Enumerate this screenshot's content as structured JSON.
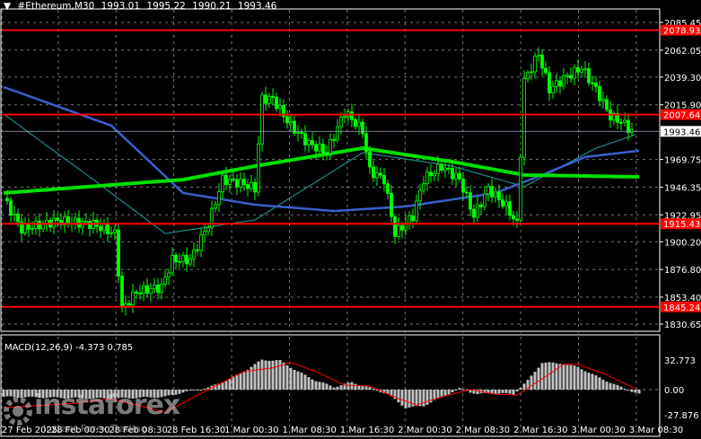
{
  "header": {
    "symbol": "#Ethereum,M30",
    "open": "1993.01",
    "high": "1995.22",
    "low": "1990.21",
    "close": "1993.46"
  },
  "price_axis": {
    "ticks": [
      "2085.45",
      "2062.05",
      "2039.30",
      "2015.90",
      "1969.75",
      "1946.35",
      "1922.95",
      "1900.20",
      "1876.80",
      "1853.40",
      "1830.65"
    ],
    "tick_values": [
      2085.45,
      2062.05,
      2039.3,
      2015.9,
      1969.75,
      1946.35,
      1922.95,
      1900.2,
      1876.8,
      1853.4,
      1830.65
    ],
    "current_price": "1993.46",
    "levels": [
      {
        "label": "2078.93",
        "value": 2078.93
      },
      {
        "label": "2007.64",
        "value": 2007.64
      },
      {
        "label": "1915.43",
        "value": 1915.43
      },
      {
        "label": "1845.24",
        "value": 1845.24
      }
    ]
  },
  "time_axis": [
    "27 Feb 2025",
    "28 Feb 00:30",
    "28 Feb 08:30",
    "28 Feb 16:30",
    "1 Mar 00:30",
    "1 Mar 08:30",
    "1 Mar 16:30",
    "2 Mar 00:30",
    "2 Mar 08:30",
    "2 Mar 16:30",
    "3 Mar 00:30",
    "3 Mar 08:30"
  ],
  "price_path": [
    [
      0,
      1937
    ],
    [
      5,
      1911
    ],
    [
      15,
      1918
    ],
    [
      25,
      1915
    ],
    [
      31,
      1907
    ],
    [
      33,
      1843
    ],
    [
      37,
      1858
    ],
    [
      44,
      1862
    ],
    [
      47,
      1885
    ],
    [
      52,
      1885
    ],
    [
      57,
      1915
    ],
    [
      61,
      1953
    ],
    [
      67,
      1949
    ],
    [
      70,
      1945
    ],
    [
      72,
      2021
    ],
    [
      75,
      2021
    ],
    [
      80,
      1998
    ],
    [
      85,
      1983
    ],
    [
      90,
      1976
    ],
    [
      95,
      2010
    ],
    [
      100,
      1994
    ],
    [
      102,
      1960
    ],
    [
      106,
      1953
    ],
    [
      109,
      1907
    ],
    [
      114,
      1922
    ],
    [
      117,
      1953
    ],
    [
      122,
      1964
    ],
    [
      127,
      1953
    ],
    [
      131,
      1922
    ],
    [
      135,
      1945
    ],
    [
      140,
      1930
    ],
    [
      143,
      1915
    ],
    [
      145,
      2036
    ],
    [
      149,
      2059
    ],
    [
      152,
      2029
    ],
    [
      157,
      2040
    ],
    [
      161,
      2047
    ],
    [
      165,
      2029
    ],
    [
      169,
      2006
    ],
    [
      172,
      2002
    ],
    [
      175,
      1993.46
    ]
  ],
  "ma_blue": [
    [
      0,
      2030.9
    ],
    [
      30,
      1998.3
    ],
    [
      50,
      1941.4
    ],
    [
      70,
      1931.5
    ],
    [
      92,
      1926.2
    ],
    [
      112,
      1930
    ],
    [
      137,
      1941.4
    ],
    [
      150,
      1956.6
    ],
    [
      162,
      1971.8
    ],
    [
      177,
      1977.1
    ]
  ],
  "ma_green": [
    [
      0,
      1941.4
    ],
    [
      50,
      1952.7
    ],
    [
      70,
      1964.1
    ],
    [
      100,
      1979.3
    ],
    [
      125,
      1967.8
    ],
    [
      145,
      1956.6
    ],
    [
      177,
      1955
    ]
  ],
  "ma_teal": [
    [
      0,
      2008.1
    ],
    [
      25,
      1952.7
    ],
    [
      45,
      1907.2
    ],
    [
      70,
      1918.6
    ],
    [
      100,
      1975.5
    ],
    [
      125,
      1964.1
    ],
    [
      145,
      1946.7
    ],
    [
      165,
      1979.3
    ],
    [
      176,
      1990.7
    ]
  ],
  "macd": {
    "label": "MACD(12,26,9) -4.373 0.785",
    "ticks": [
      "32.773",
      "0.00",
      "-27.876"
    ],
    "tick_values": [
      32.773,
      0,
      -27.876
    ],
    "histogram": [
      [
        0,
        -8
      ],
      [
        30,
        -10
      ],
      [
        45,
        -8
      ],
      [
        50,
        -3
      ],
      [
        57,
        2
      ],
      [
        62,
        10
      ],
      [
        67,
        20
      ],
      [
        72,
        33
      ],
      [
        77,
        32
      ],
      [
        82,
        20
      ],
      [
        87,
        10
      ],
      [
        92,
        3
      ],
      [
        97,
        8
      ],
      [
        102,
        2
      ],
      [
        107,
        -5
      ],
      [
        112,
        -20
      ],
      [
        117,
        -18
      ],
      [
        122,
        -8
      ],
      [
        127,
        1
      ],
      [
        132,
        -5
      ],
      [
        137,
        -4
      ],
      [
        142,
        -5
      ],
      [
        146,
        10
      ],
      [
        150,
        30
      ],
      [
        155,
        29
      ],
      [
        160,
        25
      ],
      [
        165,
        15
      ],
      [
        170,
        6
      ],
      [
        175,
        -2
      ],
      [
        177,
        -5
      ]
    ],
    "signal": [
      [
        0,
        -20
      ],
      [
        20,
        -15
      ],
      [
        30,
        -10
      ],
      [
        45,
        -25
      ],
      [
        57,
        0
      ],
      [
        67,
        20
      ],
      [
        75,
        24
      ],
      [
        80,
        30
      ],
      [
        87,
        20
      ],
      [
        95,
        5
      ],
      [
        102,
        4
      ],
      [
        110,
        -10
      ],
      [
        115,
        -17
      ],
      [
        122,
        -8
      ],
      [
        130,
        0
      ],
      [
        137,
        -5
      ],
      [
        143,
        -6
      ],
      [
        150,
        12
      ],
      [
        156,
        28
      ],
      [
        160,
        28
      ],
      [
        167,
        18
      ],
      [
        176,
        1
      ]
    ]
  },
  "watermark": {
    "brand": "instaforex",
    "tagline": "Instant Forex Trading"
  },
  "colors": {
    "level": "#ff0000",
    "ma_blue": "#3a5fcd",
    "ma_green": "#00e000",
    "ma_teal": "#1f8a8a",
    "bull": "#00ff00",
    "bear": "#ffffff",
    "macd_hist": "#c0c0c0",
    "macd_signal": "#ff0000"
  }
}
